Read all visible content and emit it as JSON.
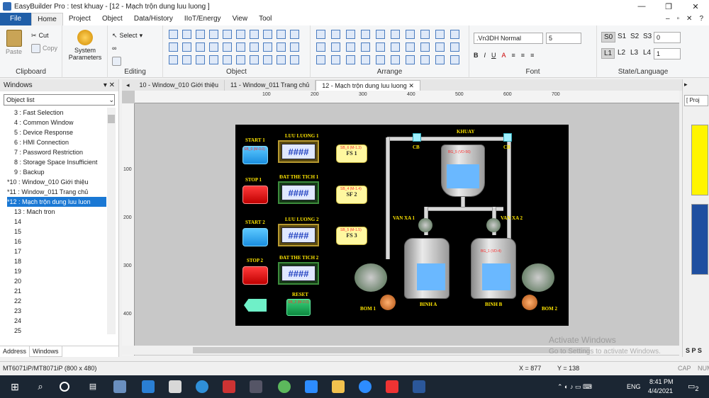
{
  "window": {
    "title": "EasyBuilder Pro : test khuay - [12 - Mạch trộn dung luu luong ]"
  },
  "menu": {
    "items": [
      "File",
      "Home",
      "Project",
      "Object",
      "Data/History",
      "IIoT/Energy",
      "View",
      "Tool"
    ],
    "active": "Home"
  },
  "ribbon": {
    "clipboard": {
      "paste": "Paste",
      "cut": "Cut",
      "copy": "Copy",
      "label": "Clipboard"
    },
    "system": {
      "label": "System\nParameters"
    },
    "editing": {
      "select": "Select",
      "label": "Editing"
    },
    "object": {
      "label": "Object"
    },
    "arrange": {
      "label": "Arrange"
    },
    "font": {
      "name": ".Vn3DH Normal",
      "size": "5",
      "label": "Font"
    },
    "state": {
      "s_buttons": [
        "S0",
        "S1",
        "S2",
        "S3"
      ],
      "s_value": "0",
      "l_buttons": [
        "L1",
        "L2",
        "L3",
        "L4"
      ],
      "l_value": "1",
      "label": "State/Language"
    }
  },
  "left_panel": {
    "title": "Windows",
    "dropdown": "Object list",
    "tree": [
      "3 : Fast Selection",
      "4 : Common Window",
      "5 : Device Response",
      "6 : HMI Connection",
      "7 : Password Restriction",
      "8 : Storage Space Insufficient",
      "9 : Backup",
      "*10 : Window_010 Giới thiệu",
      "*11 : Window_011 Trang chủ",
      "*12 : Mạch trộn dung luu luon",
      "13 : Mach tron",
      "14",
      "15",
      "16",
      "17",
      "18",
      "19",
      "20",
      "21",
      "22",
      "23",
      "24",
      "25"
    ],
    "selected_index": 9,
    "tabs": [
      "Address",
      "Windows"
    ]
  },
  "doc_tabs": [
    "10 - Window_010 Giới thiệu",
    "11 - Window_011 Trang chủ",
    "12 - Mạch trộn dung luu luong"
  ],
  "ruler": {
    "h_ticks": [
      "100",
      "200",
      "300",
      "400",
      "500",
      "600",
      "700"
    ],
    "v_ticks": [
      "100",
      "200",
      "300",
      "400"
    ]
  },
  "hmi": {
    "labels": {
      "start1": "START 1",
      "stop1": "STOP 1",
      "start2": "START 2",
      "stop2": "STOP 2",
      "luuluong1": "LUU LUONG 1",
      "datthetich1": "ĐAT THE TICH 1",
      "luuluong2": "LUU LUONG 2",
      "datthetich2": "ĐAT THE TICH 2",
      "reset": "RESET",
      "khuay": "KHUAY",
      "cb1": "CB",
      "cb2": "CB",
      "vanxa1": "VAN XA 1",
      "vanxa2": "VAN XA 2",
      "binha": "BINH A",
      "binhb": "BINH B",
      "bom1": "BOM 1",
      "bom2": "BOM 2"
    },
    "numeric": [
      "####",
      "####",
      "####",
      "####"
    ],
    "fs": [
      "FS 1",
      "SF 2",
      "FS 3"
    ],
    "tags": [
      "SB_0 (M-0.0)",
      "SB_6 (M-1.3)",
      "SB_4 (M-1.4)",
      "SB_5 (M-1.5)",
      "SB_3 (M-0.3)",
      "SB_2 (M-2.0)",
      "BG_1 (VD-4)",
      "BG_5 (VD-56)"
    ]
  },
  "status": {
    "model": "MT6071iP/MT8071iP (800 x 480)",
    "x": "X = 877",
    "y": "Y = 138",
    "cap": "CAP",
    "num": "NUM"
  },
  "watermark": {
    "line1": "Activate Windows",
    "line2": "Go to Settings to activate Windows."
  },
  "right_strip": {
    "tab": "[ Proj",
    "sps": "S P S"
  },
  "taskbar": {
    "lang": "ENG",
    "time": "8:41 PM",
    "date": "4/4/2021",
    "notif": "2"
  }
}
